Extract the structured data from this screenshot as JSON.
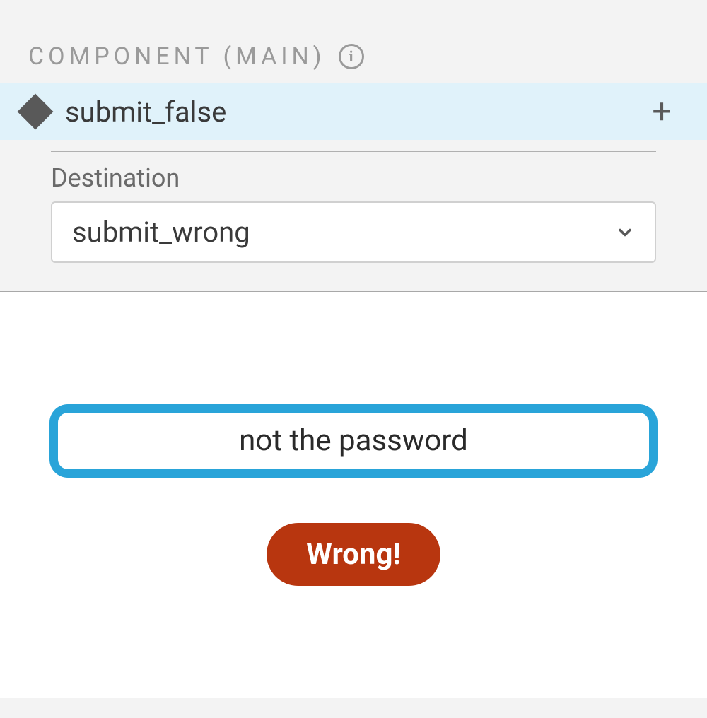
{
  "panel": {
    "section_label": "COMPONENT (MAIN)",
    "component_name": "submit_false",
    "destination_label": "Destination",
    "destination_value": "submit_wrong"
  },
  "preview": {
    "input_value": "not the password",
    "button_label": "Wrong!"
  },
  "colors": {
    "highlight": "#e0f2fa",
    "select_border": "#d0d0d0",
    "input_ring": "#29a4d9",
    "button_bg": "#b8360f"
  }
}
